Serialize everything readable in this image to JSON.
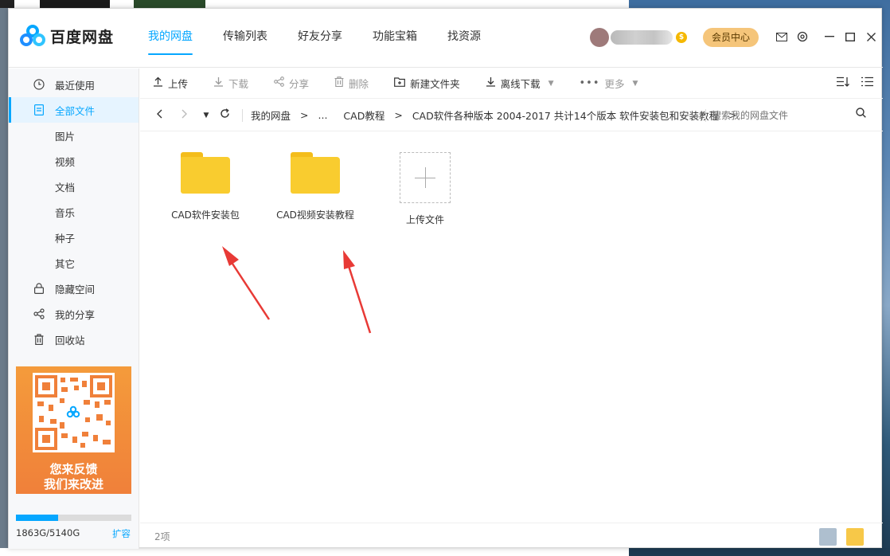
{
  "app": {
    "logo_text": "百度网盘"
  },
  "nav": {
    "tabs": [
      "我的网盘",
      "传输列表",
      "好友分享",
      "功能宝箱",
      "找资源"
    ],
    "active": 0
  },
  "header": {
    "coin_symbol": "$",
    "vip_label": "会员中心"
  },
  "sidebar": {
    "items": [
      {
        "label": "最近使用",
        "icon": "clock-icon",
        "type": "main"
      },
      {
        "label": "全部文件",
        "icon": "file-icon",
        "type": "main",
        "active": true
      },
      {
        "label": "图片",
        "type": "sub"
      },
      {
        "label": "视频",
        "type": "sub"
      },
      {
        "label": "文档",
        "type": "sub"
      },
      {
        "label": "音乐",
        "type": "sub"
      },
      {
        "label": "种子",
        "type": "sub"
      },
      {
        "label": "其它",
        "type": "sub"
      },
      {
        "label": "隐藏空间",
        "icon": "lock-icon",
        "type": "main"
      },
      {
        "label": "我的分享",
        "icon": "share-icon",
        "type": "main"
      },
      {
        "label": "回收站",
        "icon": "trash-icon",
        "type": "main"
      }
    ],
    "feedback_line1": "您来反馈",
    "feedback_line2": "我们来改进",
    "storage_text": "1863G/5140G",
    "storage_fraction": 0.3625,
    "expand_label": "扩容"
  },
  "toolbar": {
    "upload": "上传",
    "download": "下载",
    "share": "分享",
    "delete": "删除",
    "new_folder": "新建文件夹",
    "offline_download": "离线下载",
    "more": "更多"
  },
  "pathbar": {
    "crumbs": [
      "我的网盘",
      "...",
      "CAD教程",
      "CAD软件各种版本 2004-2017 共计14个版本 软件安装包和安装教程"
    ],
    "separator": ">",
    "search_placeholder": "搜索我的网盘文件"
  },
  "files": [
    {
      "name": "CAD软件安装包",
      "type": "folder"
    },
    {
      "name": "CAD视频安装教程",
      "type": "folder"
    }
  ],
  "upload_tile_label": "上传文件",
  "status": {
    "count": "2项"
  },
  "colors": {
    "accent": "#06a7ff",
    "folder": "#f9cc2f",
    "annotation_arrow": "#e83a36"
  }
}
